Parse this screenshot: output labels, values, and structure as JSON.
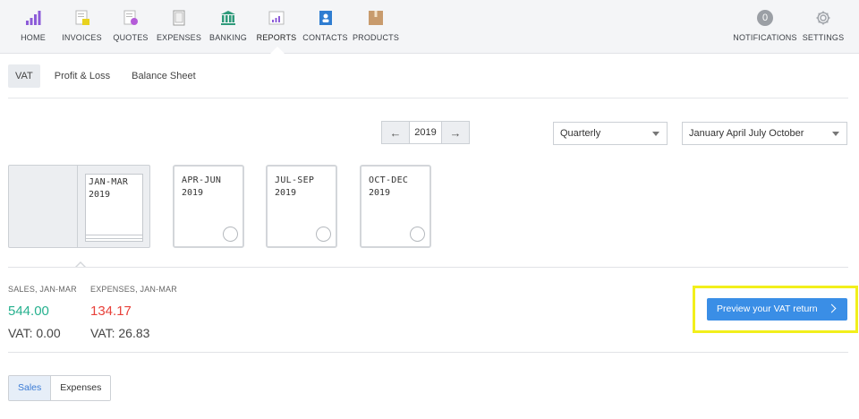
{
  "nav": {
    "items": [
      {
        "label": "HOME",
        "icon": "home-bars-icon"
      },
      {
        "label": "INVOICES",
        "icon": "invoices-icon"
      },
      {
        "label": "QUOTES",
        "icon": "quotes-icon"
      },
      {
        "label": "EXPENSES",
        "icon": "expenses-icon"
      },
      {
        "label": "BANKING",
        "icon": "bank-icon"
      },
      {
        "label": "REPORTS",
        "icon": "reports-icon"
      },
      {
        "label": "CONTACTS",
        "icon": "contacts-icon"
      },
      {
        "label": "PRODUCTS",
        "icon": "products-icon"
      }
    ],
    "active": "REPORTS",
    "notifications": {
      "label": "NOTIFICATIONS",
      "count": "0"
    },
    "settings": {
      "label": "SETTINGS"
    }
  },
  "subtabs": {
    "items": [
      "VAT",
      "Profit & Loss",
      "Balance Sheet"
    ],
    "active": "VAT"
  },
  "period": {
    "year": "2019",
    "frequency": "Quarterly",
    "months": "January April July October"
  },
  "quarters": [
    {
      "title": "JAN-MAR",
      "year": "2019",
      "selected": true
    },
    {
      "title": "APR-JUN",
      "year": "2019"
    },
    {
      "title": "JUL-SEP",
      "year": "2019"
    },
    {
      "title": "OCT-DEC",
      "year": "2019"
    }
  ],
  "summary": {
    "sales": {
      "label": "SALES, JAN-MAR",
      "value": "544.00",
      "vat": "VAT: 0.00"
    },
    "expenses": {
      "label": "EXPENSES, JAN-MAR",
      "value": "134.17",
      "vat": "VAT: 26.83"
    }
  },
  "preview_button": {
    "label": "Preview your VAT return"
  },
  "bottom_tabs": {
    "items": [
      "Sales",
      "Expenses"
    ],
    "active": "Sales"
  },
  "colors": {
    "accent_blue": "#3a8ee6",
    "positive_green": "#27b18f",
    "negative_red": "#e8413a",
    "highlight_yellow": "#f2ef1b"
  }
}
